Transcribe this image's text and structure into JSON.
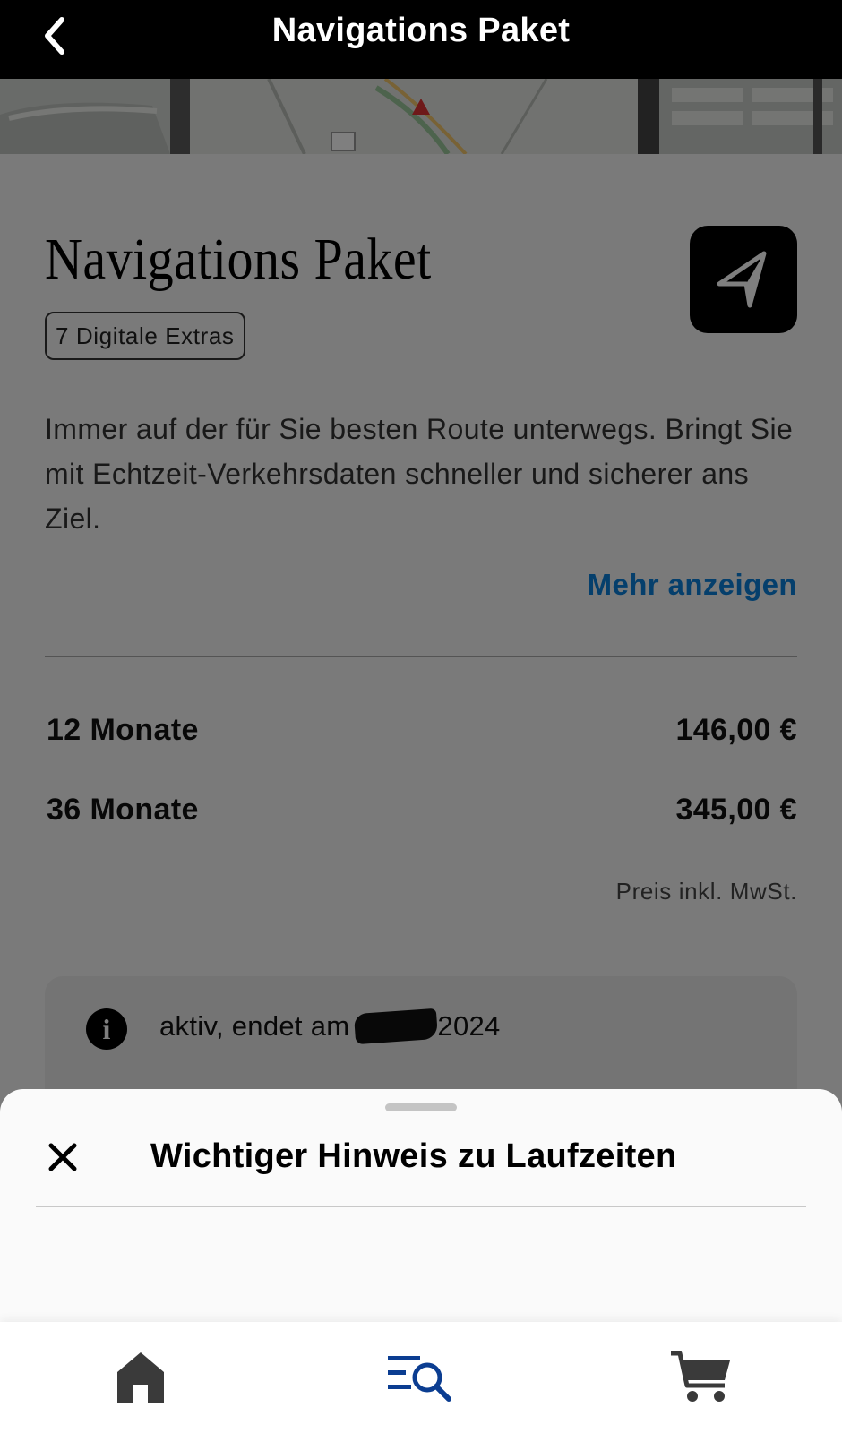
{
  "header": {
    "title": "Navigations Paket"
  },
  "product": {
    "title": "Navigations Paket",
    "badge": "7 Digitale Extras",
    "description": "Immer auf der für Sie besten Route unterwegs. Bringt Sie mit Echtzeit-Verkehrsdaten schneller und sicherer ans Ziel.",
    "more_link": "Mehr anzeigen"
  },
  "pricing": {
    "options": [
      {
        "term": "12 Monate",
        "price": "146,00 €"
      },
      {
        "term": "36 Monate",
        "price": "345,00 €"
      }
    ],
    "vat_note": "Preis inkl. MwSt."
  },
  "status": {
    "prefix": "aktiv, endet am",
    "suffix": "2024"
  },
  "sheet": {
    "title": "Wichtiger Hinweis zu Laufzeiten"
  },
  "tabs": [
    {
      "name": "home",
      "icon": "home-icon"
    },
    {
      "name": "browse",
      "icon": "list-search-icon",
      "active": true
    },
    {
      "name": "cart",
      "icon": "cart-icon"
    }
  ],
  "colors": {
    "accent": "#0a7fd8",
    "active_tab": "#0b3d91",
    "header_bg": "#000000"
  }
}
